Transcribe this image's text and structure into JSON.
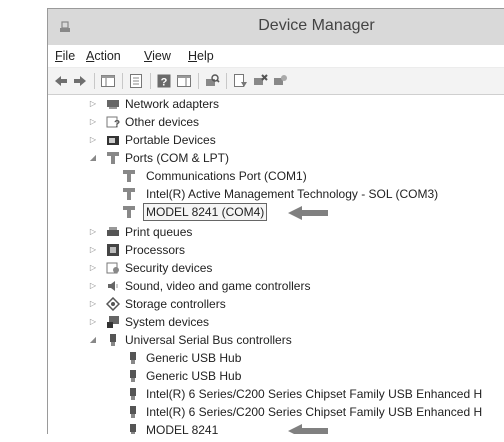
{
  "window": {
    "title": "Device Manager"
  },
  "menu": {
    "items": [
      {
        "pre": "",
        "key": "F",
        "post": "ile"
      },
      {
        "pre": "",
        "key": "A",
        "post": "ction"
      },
      {
        "pre": "",
        "key": "V",
        "post": "iew"
      },
      {
        "pre": "",
        "key": "H",
        "post": "elp"
      }
    ]
  },
  "toolbar": {
    "icons": [
      "back-arrow-icon",
      "forward-arrow-icon",
      "show-hide-console-tree-icon",
      "properties-icon",
      "help-icon",
      "action-pane-icon",
      "scan-hardware-icon",
      "update-driver-icon",
      "disable-device-icon",
      "uninstall-device-icon"
    ]
  },
  "tree": {
    "categories": [
      {
        "label": "Network adapters",
        "icon": "network-adapter-icon",
        "expanded": false
      },
      {
        "label": "Other devices",
        "icon": "unknown-device-icon",
        "expanded": false
      },
      {
        "label": "Portable Devices",
        "icon": "portable-device-icon",
        "expanded": false
      },
      {
        "label": "Ports (COM & LPT)",
        "icon": "port-icon",
        "expanded": true,
        "children": [
          "Communications Port (COM1)",
          "Intel(R) Active Management Technology - SOL (COM3)",
          "MODEL 8241 (COM4)"
        ]
      },
      {
        "label": "Print queues",
        "icon": "printer-icon",
        "expanded": false
      },
      {
        "label": "Processors",
        "icon": "processor-icon",
        "expanded": false
      },
      {
        "label": "Security devices",
        "icon": "security-device-icon",
        "expanded": false
      },
      {
        "label": "Sound, video and game controllers",
        "icon": "speaker-icon",
        "expanded": false
      },
      {
        "label": "Storage controllers",
        "icon": "storage-controller-icon",
        "expanded": false
      },
      {
        "label": "System devices",
        "icon": "system-device-icon",
        "expanded": false
      },
      {
        "label": "Universal Serial Bus controllers",
        "icon": "usb-icon",
        "expanded": true,
        "children": [
          "Generic USB Hub",
          "Generic USB Hub",
          "Intel(R) 6 Series/C200 Series Chipset Family USB Enhanced H",
          "Intel(R) 6 Series/C200 Series Chipset Family USB Enhanced H",
          "MODEL 8241"
        ]
      }
    ]
  },
  "colors": {
    "titlebar": "#d9d9d9",
    "arrow": "#808080"
  }
}
